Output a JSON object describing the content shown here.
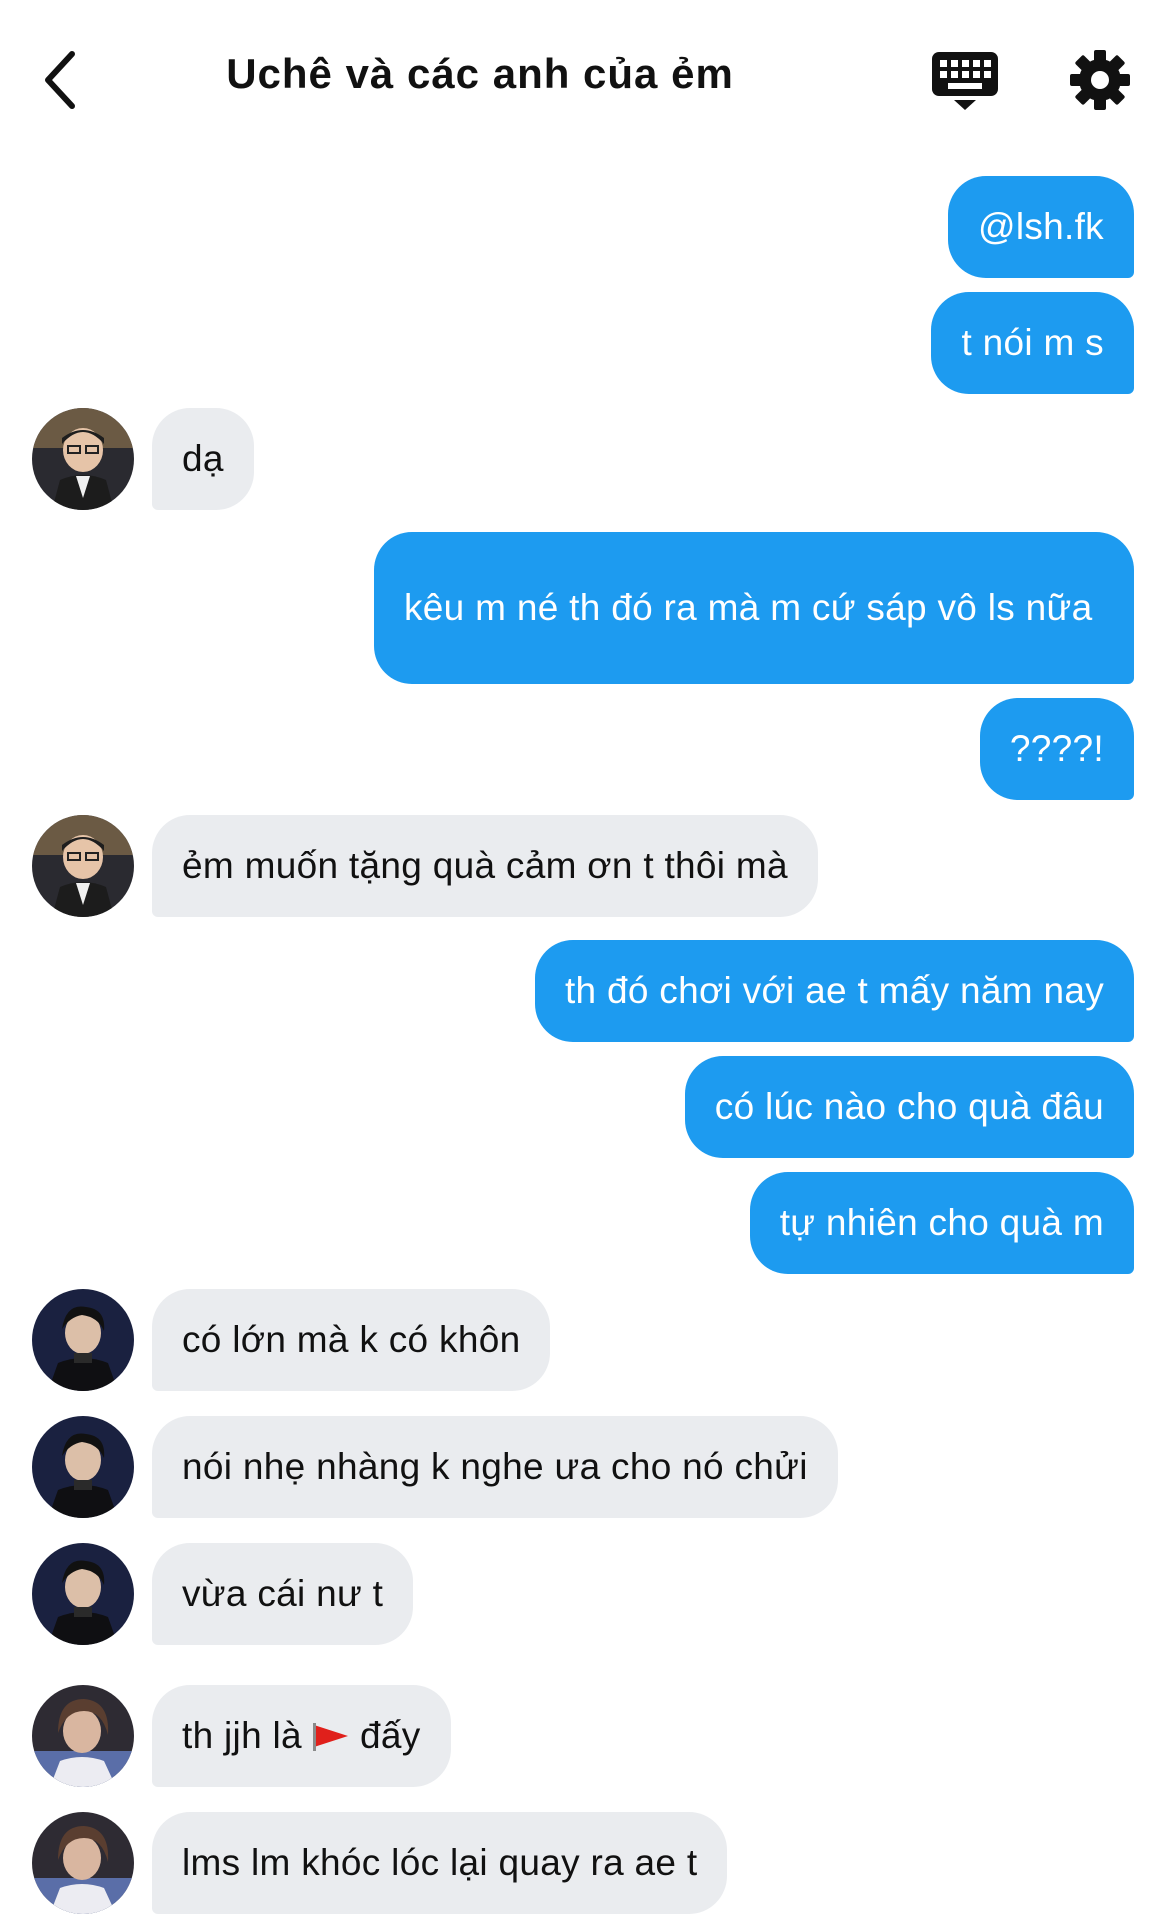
{
  "header": {
    "title": "Uchê và các anh của ẻm",
    "back_icon": "chevron-left-icon",
    "keyboard_icon": "keyboard-icon",
    "settings_icon": "gear-icon"
  },
  "colors": {
    "outgoing_bubble": "#1d9bf0",
    "incoming_bubble": "#eaecef",
    "flag": "#e0201b"
  },
  "messages": [
    {
      "dir": "out",
      "text": "@lsh.fk"
    },
    {
      "dir": "out",
      "text": "t nói m s"
    },
    {
      "dir": "in",
      "sender": "user-a",
      "text": "dạ"
    },
    {
      "dir": "out",
      "text": "kêu m né th đó ra mà m cứ sáp vô ls nữa"
    },
    {
      "dir": "out",
      "text": "????!"
    },
    {
      "dir": "in",
      "sender": "user-a",
      "text": "ẻm muốn tặng quà cảm ơn t thôi mà"
    },
    {
      "dir": "out",
      "text": "th đó chơi với ae t mấy năm nay"
    },
    {
      "dir": "out",
      "text": "có lúc nào cho quà đâu"
    },
    {
      "dir": "out",
      "text": "tự nhiên cho quà m"
    },
    {
      "dir": "in",
      "sender": "user-b",
      "text": "có lớn mà k có khôn"
    },
    {
      "dir": "in",
      "sender": "user-b",
      "text": "nói nhẹ nhàng k nghe ưa cho nó chửi"
    },
    {
      "dir": "in",
      "sender": "user-b",
      "text": "vừa cái nư t"
    },
    {
      "dir": "in",
      "sender": "user-c",
      "text_before": "th jjh là",
      "emoji": "triangular-flag-icon",
      "text_after": "đấy"
    },
    {
      "dir": "in",
      "sender": "user-c",
      "text": "lms lm khóc lóc lại quay ra ae t"
    }
  ]
}
